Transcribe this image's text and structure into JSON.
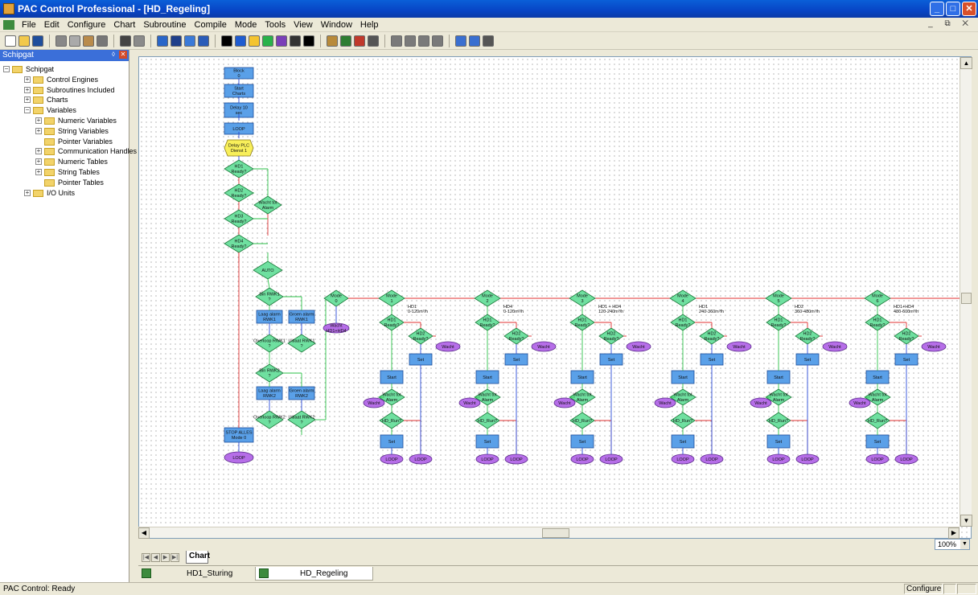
{
  "window": {
    "title": "PAC Control Professional - [HD_Regeling]",
    "buttons": {
      "minimize": "_",
      "maximize": "□",
      "close": "✕"
    }
  },
  "menu": {
    "items": [
      "File",
      "Edit",
      "Configure",
      "Chart",
      "Subroutine",
      "Compile",
      "Mode",
      "Tools",
      "View",
      "Window",
      "Help"
    ],
    "mdi_controls": "_ ⧉ ✕"
  },
  "toolbar": {
    "icons": [
      {
        "name": "new-icon",
        "color": "#ffffff"
      },
      {
        "name": "open-icon",
        "color": "#f2c94c"
      },
      {
        "name": "save-icon",
        "color": "#1f4e9c"
      },
      {
        "name": "sep"
      },
      {
        "name": "cut-icon",
        "color": "#888888"
      },
      {
        "name": "copy-icon",
        "color": "#aaaaaa"
      },
      {
        "name": "paste-icon",
        "color": "#b98b4b"
      },
      {
        "name": "delete-icon",
        "color": "#777777"
      },
      {
        "name": "sep"
      },
      {
        "name": "find-icon",
        "color": "#444444"
      },
      {
        "name": "replace-icon",
        "color": "#8a8a8a"
      },
      {
        "name": "sep"
      },
      {
        "name": "debug-icon",
        "color": "#2a66c8"
      },
      {
        "name": "compile-icon",
        "color": "#1f3f8a"
      },
      {
        "name": "configure-icon",
        "color": "#3a7ad8"
      },
      {
        "name": "help-icon",
        "color": "#2a5cb8"
      },
      {
        "name": "sep"
      },
      {
        "name": "select-tool-icon",
        "color": "#000000"
      },
      {
        "name": "action-block-icon",
        "color": "#1f5cd0"
      },
      {
        "name": "oia-block-icon",
        "color": "#f4c430"
      },
      {
        "name": "condition-block-icon",
        "color": "#29b24a"
      },
      {
        "name": "continue-block-icon",
        "color": "#7a3fb8"
      },
      {
        "name": "connection-icon",
        "color": "#333333"
      },
      {
        "name": "text-icon",
        "color": "#000000"
      },
      {
        "name": "sep"
      },
      {
        "name": "zoom-icon",
        "color": "#b88a3a"
      },
      {
        "name": "block-id-icon",
        "color": "#2e7d32"
      },
      {
        "name": "numbering-icon",
        "color": "#c0392b"
      },
      {
        "name": "align-icon",
        "color": "#555555"
      },
      {
        "name": "sep"
      },
      {
        "name": "run-icon",
        "color": "#7a7a7a"
      },
      {
        "name": "stop-icon",
        "color": "#7a7a7a"
      },
      {
        "name": "pause-icon",
        "color": "#7a7a7a"
      },
      {
        "name": "step-icon",
        "color": "#7a7a7a"
      },
      {
        "name": "sep"
      },
      {
        "name": "zoom-in-icon",
        "color": "#3a6fd0"
      },
      {
        "name": "zoom-out-icon",
        "color": "#3a6fd0"
      },
      {
        "name": "hex-icon",
        "color": "#555555"
      }
    ]
  },
  "strategy_tree": {
    "panel_title": "Schipgat",
    "rows": [
      {
        "label": "Schipgat",
        "level": 0,
        "exp": "−"
      },
      {
        "label": "Control Engines",
        "level": 1,
        "exp": "+"
      },
      {
        "label": "Subroutines Included",
        "level": 1,
        "exp": "+"
      },
      {
        "label": "Charts",
        "level": 1,
        "exp": "+"
      },
      {
        "label": "Variables",
        "level": 1,
        "exp": "−"
      },
      {
        "label": "Numeric Variables",
        "level": 2,
        "exp": "+"
      },
      {
        "label": "String Variables",
        "level": 2,
        "exp": "+"
      },
      {
        "label": "Pointer Variables",
        "level": 2,
        "exp": ""
      },
      {
        "label": "Communication Handles",
        "level": 2,
        "exp": "+"
      },
      {
        "label": "Numeric Tables",
        "level": 2,
        "exp": "+"
      },
      {
        "label": "String Tables",
        "level": 2,
        "exp": "+"
      },
      {
        "label": "Pointer Tables",
        "level": 2,
        "exp": ""
      },
      {
        "label": "I/O Units",
        "level": 1,
        "exp": "+"
      }
    ]
  },
  "flowchart": {
    "main_column": {
      "blocks": [
        "Block 0",
        "Start Charts",
        "Delay 10 sec",
        "LOOP"
      ],
      "delay_oia": "Delay PLC Dienst 1",
      "conditions": [
        "HD1 Ready?",
        "HD2 Ready?",
        "HD3 Ready?",
        "HD4 Ready?"
      ],
      "alarm": "Wacht tot Alarm",
      "auto": "AUTO",
      "stop": "STOP ALLES Mode 0",
      "loop": "LOOP",
      "false_label": "F",
      "true_label": "T"
    },
    "pump_checks": {
      "rwk1": "Bin RWK1 ?",
      "long1": "Laag alarm RWK1",
      "green1": "Groen alarm RWK1",
      "over1": "Overloop RWK1 ?",
      "uit1": "Uitlaat RWK1 ?",
      "rwk2": "Bin RWK2 ?",
      "long2": "Laag alarm RWK2",
      "green2": "Groen alarm RWK2",
      "over2": "Overloop RWK2 ?",
      "uit2": "Uitlaat RWK2 ?"
    },
    "modes": [
      {
        "name": "Mode 1",
        "note1": "HD1",
        "note2": "0-120m³/h"
      },
      {
        "name": "Mode 2",
        "note1": "HD4",
        "note2": "0-120m³/h"
      },
      {
        "name": "Mode 3",
        "note1": "HD1 + HD4",
        "note2": "120-240m³/h"
      },
      {
        "name": "Mode 4",
        "note1": "HD1",
        "note2": "240-360m³/h"
      },
      {
        "name": "Mode 5",
        "note1": "HD2",
        "note2": "360-480m³/h"
      },
      {
        "name": "Mode 6",
        "note1": "HD1+HD4",
        "note2": "480-600m³/h"
      }
    ],
    "mode_entry": "Mode 0",
    "mode_entry_wait": "Wacht HD1+HD4",
    "col_labels": {
      "start": "Start",
      "ready_hd1": "HD1 Ready?",
      "ready_hd2": "HD2 Ready?",
      "ready_hd3": "HD3 Ready?",
      "ready_hd4": "HD4 Ready?",
      "set": "Set",
      "wait_alarm": "Wacht tot Alarm",
      "hd_run": "HD_Run?",
      "wait": "Wacht",
      "loop": "LOOP",
      "hd14": "HD1+HD4 Ready?"
    }
  },
  "canvas": {
    "zoom": "100%",
    "chart_tab": "Chart",
    "scroll_arrows": {
      "up": "▲",
      "down": "▼",
      "left": "◀",
      "right": "▶"
    }
  },
  "document_tabs": [
    "HD1_Sturing",
    "HD_Regeling"
  ],
  "status": {
    "text": "PAC Control: Ready",
    "mode": "Configure"
  }
}
